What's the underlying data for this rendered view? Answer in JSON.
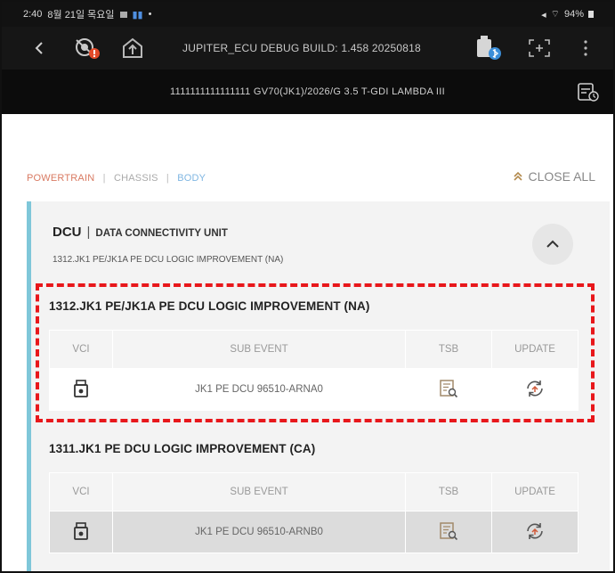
{
  "status_bar": {
    "time": "2:40",
    "date": "8월 21일 목요일",
    "battery": "94%"
  },
  "toolbar": {
    "title": "JUPITER_ECU DEBUG BUILD: 1.458 20250818"
  },
  "vehicle_bar": {
    "vehicle": "1111111111111111   GV70(JK1)/2026/G 3.5 T-GDI LAMBDA III"
  },
  "categories": {
    "powertrain": "POWERTRAIN",
    "chassis": "CHASSIS",
    "body": "BODY",
    "separator": "|"
  },
  "close_all_label": "CLOSE ALL",
  "unit": {
    "code": "DCU",
    "separator": "|",
    "name": "DATA CONNECTIVITY UNIT",
    "subtitle": "1312.JK1 PE/JK1A PE DCU LOGIC IMPROVEMENT (NA)"
  },
  "events": [
    {
      "title": "1312.JK1 PE/JK1A PE DCU LOGIC IMPROVEMENT (NA)",
      "columns": [
        "VCI",
        "SUB EVENT",
        "TSB",
        "UPDATE"
      ],
      "row": {
        "sub_event": "JK1 PE DCU 96510-ARNA0",
        "highlighted": false
      }
    },
    {
      "title": "1311.JK1 PE DCU LOGIC IMPROVEMENT (CA)",
      "columns": [
        "VCI",
        "SUB EVENT",
        "TSB",
        "UPDATE"
      ],
      "row": {
        "sub_event": "JK1 PE DCU 96510-ARNB0",
        "highlighted": true
      }
    }
  ],
  "icons": [
    "back-icon",
    "vci-status-icon",
    "home-upload-icon",
    "vci-connect-icon",
    "fullscreen-icon",
    "more-icon",
    "vehicle-info-icon",
    "usb-icon",
    "tsb-icon",
    "update-icon",
    "chevron-up-icon",
    "double-chevron-up-icon"
  ],
  "colors": {
    "accent_panel": "#7fc7d9",
    "powertrain": "#d97a62",
    "body": "#7fb6e2",
    "highlight": "#e8171b",
    "alert": "#e34b2a",
    "bluetooth": "#3b8ed8"
  }
}
